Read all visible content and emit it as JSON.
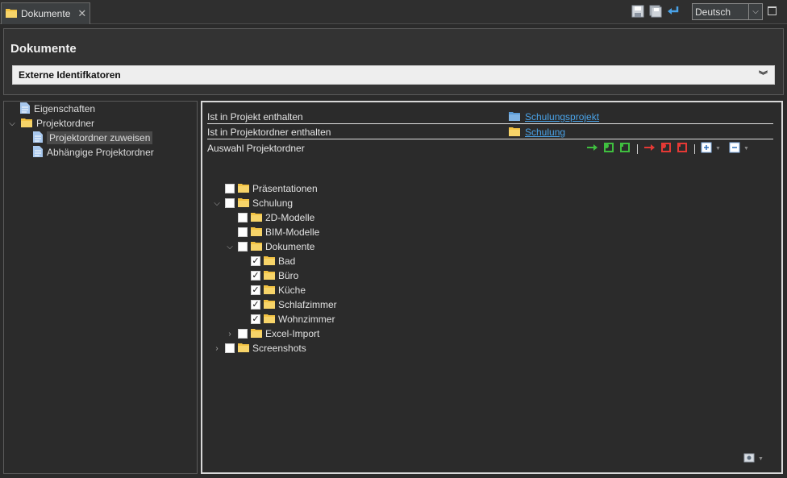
{
  "tab": {
    "title": "Dokumente"
  },
  "language": {
    "selected": "Deutsch"
  },
  "header": {
    "title": "Dokumente",
    "section": "Externe Identifkatoren"
  },
  "left_tree": [
    {
      "label": "Eigenschaften"
    },
    {
      "label": "Projektordner"
    },
    {
      "label": "Projektordner zuweisen"
    },
    {
      "label": "Abhängige Projektordner"
    }
  ],
  "properties": {
    "project_label": "Ist in Projekt enthalten",
    "project_value": "Schulungsprojekt",
    "folder_label": "Ist in Projektordner enthalten",
    "folder_value": "Schulung",
    "selection_label": "Auswahl Projektordner"
  },
  "folder_tree": [
    {
      "label": "Präsentationen",
      "checked": false
    },
    {
      "label": "Schulung",
      "checked": false
    },
    {
      "label": "2D-Modelle",
      "checked": false
    },
    {
      "label": "BIM-Modelle",
      "checked": false
    },
    {
      "label": "Dokumente",
      "checked": false
    },
    {
      "label": "Bad",
      "checked": true
    },
    {
      "label": "Büro",
      "checked": true
    },
    {
      "label": "Küche",
      "checked": true
    },
    {
      "label": "Schlafzimmer",
      "checked": true
    },
    {
      "label": "Wohnzimmer",
      "checked": true
    },
    {
      "label": "Excel-Import",
      "checked": false
    },
    {
      "label": "Screenshots",
      "checked": false
    }
  ],
  "colors": {
    "link": "#4aa3e8",
    "folder": "#f3c343",
    "green_action": "#3fbf3f",
    "red_action": "#e53935",
    "doc_icon": "#a8c8ee"
  }
}
